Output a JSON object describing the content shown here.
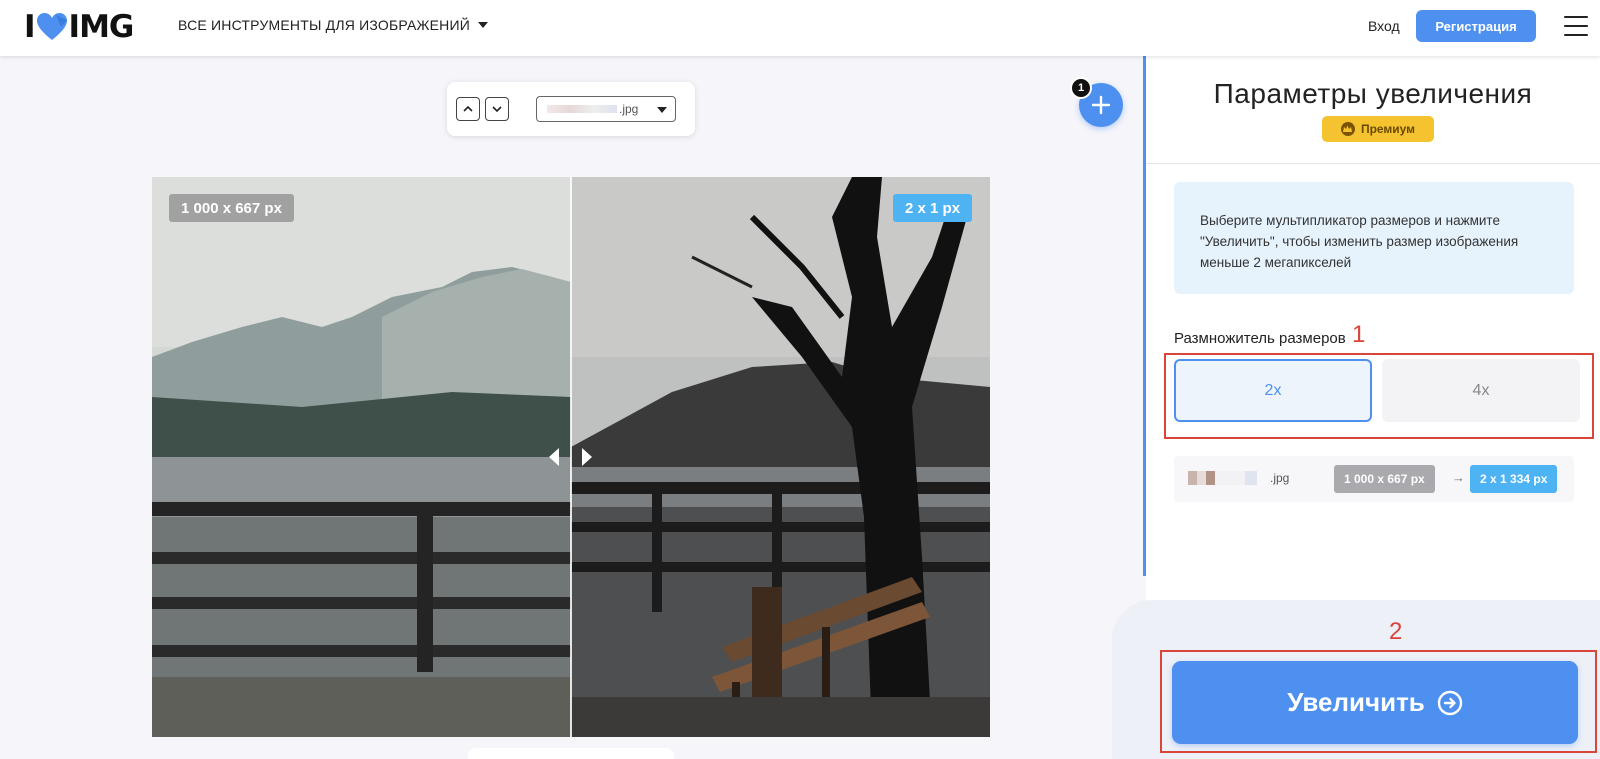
{
  "header": {
    "logo_left": "I",
    "logo_right": "IMG",
    "tools_menu_label": "ВСЕ ИНСТРУМЕНТЫ ДЛЯ ИЗОБРАЖЕНИЙ",
    "login_label": "Вход",
    "register_label": "Регистрация"
  },
  "file_toolbar": {
    "selected_file": ".jpg"
  },
  "add_button": {
    "file_count": "1"
  },
  "preview": {
    "original_size": "1 000 x 667 px",
    "result_size": "2 x 1 px"
  },
  "panel": {
    "title": "Параметры увеличения",
    "premium_label": "Премиум",
    "info_text": "Выберите мультипликатор размеров и нажмите \"Увеличить\", чтобы изменить размер изображения меньше 2 мегапикселей",
    "multiplier_label": "Размножитель размеров",
    "multiplier_options": [
      "2x",
      "4x"
    ],
    "selected_multiplier": "2x",
    "file_ext": ".jpg",
    "size_from": "1 000 x 667 px",
    "size_arrow": "→",
    "size_to": "2 x 1 334 px",
    "enlarge_label": "Увеличить"
  },
  "annotations": [
    "1",
    "2"
  ],
  "colors": {
    "accent": "#4d90f0",
    "premium": "#f5c330",
    "size_tag_result": "#4db3f3",
    "annotation": "#d9453a"
  }
}
